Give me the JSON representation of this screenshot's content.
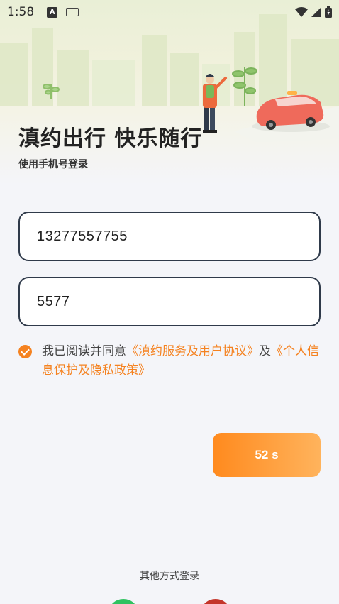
{
  "status_bar": {
    "time": "1:58",
    "notification_badge": "A",
    "icons": [
      "keyboard-icon",
      "wifi-icon",
      "signal-icon",
      "battery-charging-icon"
    ]
  },
  "header": {
    "title": "滇约出行 快乐随行",
    "subtitle": "使用手机号登录"
  },
  "form": {
    "phone_value": "13277557755",
    "code_value": "5577"
  },
  "agreement": {
    "checked": true,
    "prefix": "我已阅读并同意",
    "link1": "《滇约服务及用户协议》",
    "middle": "及",
    "link2": "《个人信息保护及隐私政策》"
  },
  "countdown": {
    "label": "52 s"
  },
  "other_login": {
    "label": "其他方式登录"
  },
  "colors": {
    "accent": "#f58220",
    "button_gradient_start": "#ff8a1e",
    "button_gradient_end": "#ffb35c",
    "field_border": "#2f3a4a",
    "background": "#f4f5f9"
  }
}
